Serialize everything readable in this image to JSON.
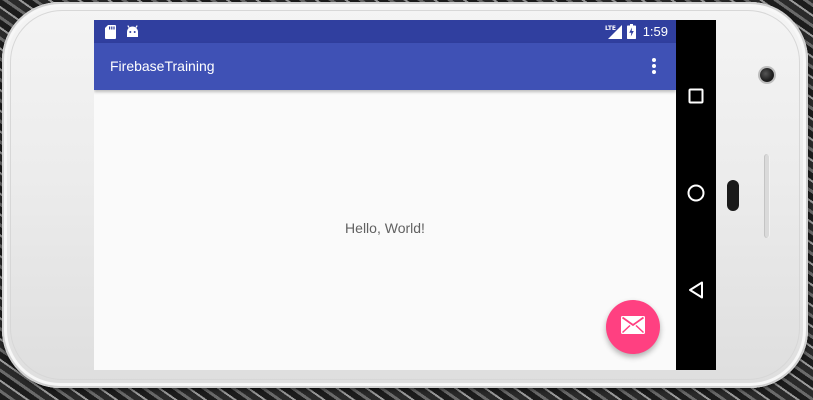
{
  "status_bar": {
    "time": "1:59",
    "left_icons": [
      "sd-card-icon",
      "android-icon"
    ],
    "right_icons": [
      "lte-signal-icon",
      "battery-charging-icon"
    ]
  },
  "app_bar": {
    "title": "FirebaseTraining",
    "menu_icon": "more-vert-icon"
  },
  "content": {
    "text": "Hello, World!"
  },
  "fab": {
    "icon": "email-icon",
    "color": "#ff4081"
  },
  "nav_bar": {
    "buttons": [
      "recents-icon",
      "home-icon",
      "back-icon"
    ]
  },
  "colors": {
    "status_bar": "#303f9f",
    "app_bar": "#3f51b5",
    "background": "#fafafa",
    "accent": "#ff4081"
  }
}
